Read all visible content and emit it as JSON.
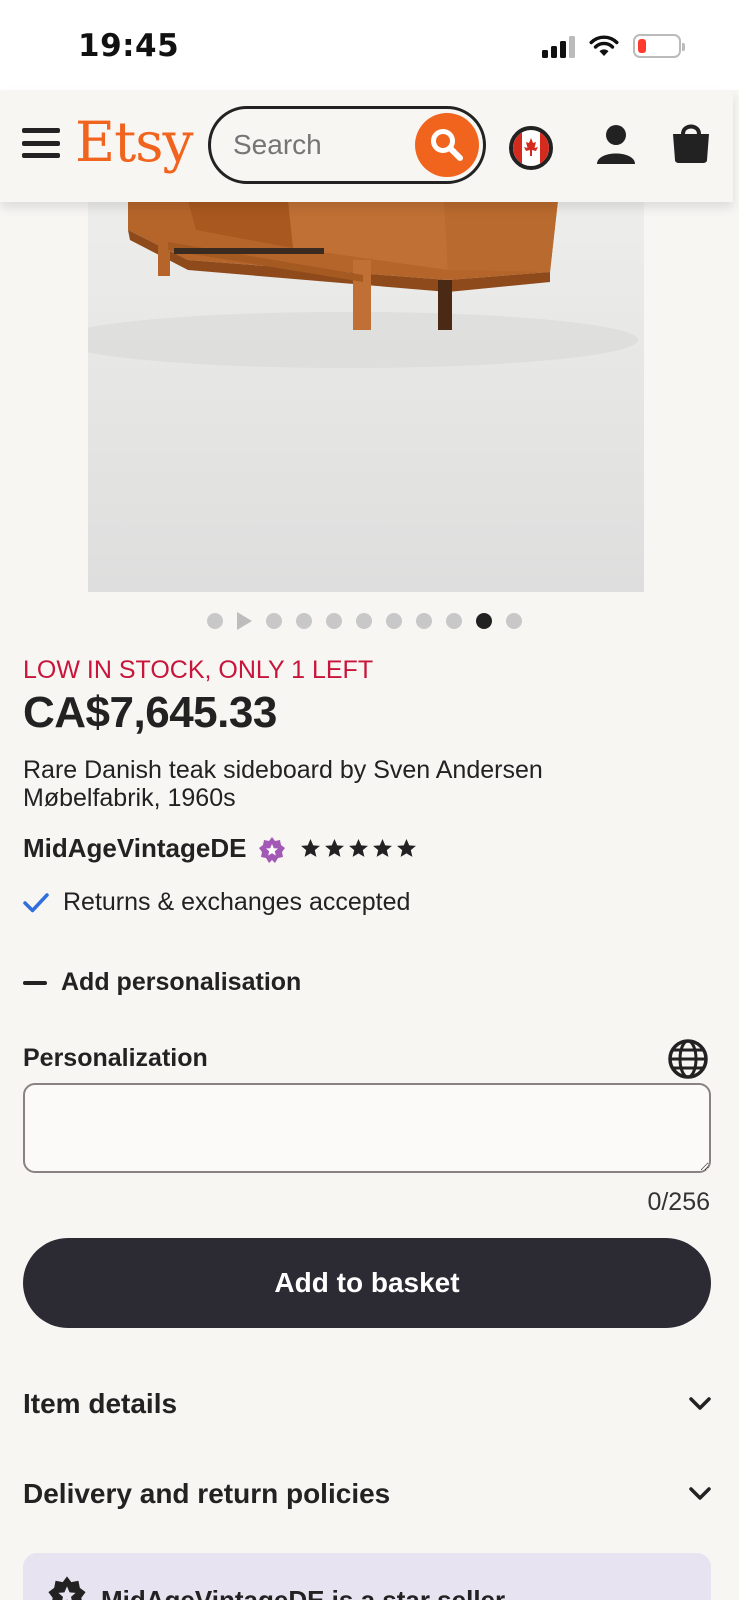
{
  "status_bar": {
    "time": "19:45"
  },
  "header": {
    "logo": "Etsy",
    "search_placeholder": "Search"
  },
  "product": {
    "stock_notice": "LOW IN STOCK, ONLY 1 LEFT",
    "price": "CA$7,645.33",
    "title": "Rare Danish teak sideboard by Sven Andersen Møbelfabrik, 1960s",
    "shop_name": "MidAgeVintageDE",
    "rating_stars": 5,
    "returns": "Returns & exchanges accepted",
    "carousel": {
      "total_images": 10,
      "active_index": 9,
      "has_video": true
    }
  },
  "personalisation": {
    "toggle_label": "Add personalisation",
    "field_label": "Personalization",
    "value": "",
    "counter": "0/256"
  },
  "actions": {
    "add_to_basket": "Add to basket"
  },
  "accordions": [
    {
      "label": "Item details"
    },
    {
      "label": "Delivery and return policies"
    }
  ],
  "banner": {
    "text": "MidAgeVintageDE is a star seller"
  },
  "colors": {
    "brand": "#f1641e",
    "stock_alert": "#c7153b",
    "button_dark": "#2c2a33",
    "star_seller": "#a259b5",
    "check": "#2f6fde"
  }
}
